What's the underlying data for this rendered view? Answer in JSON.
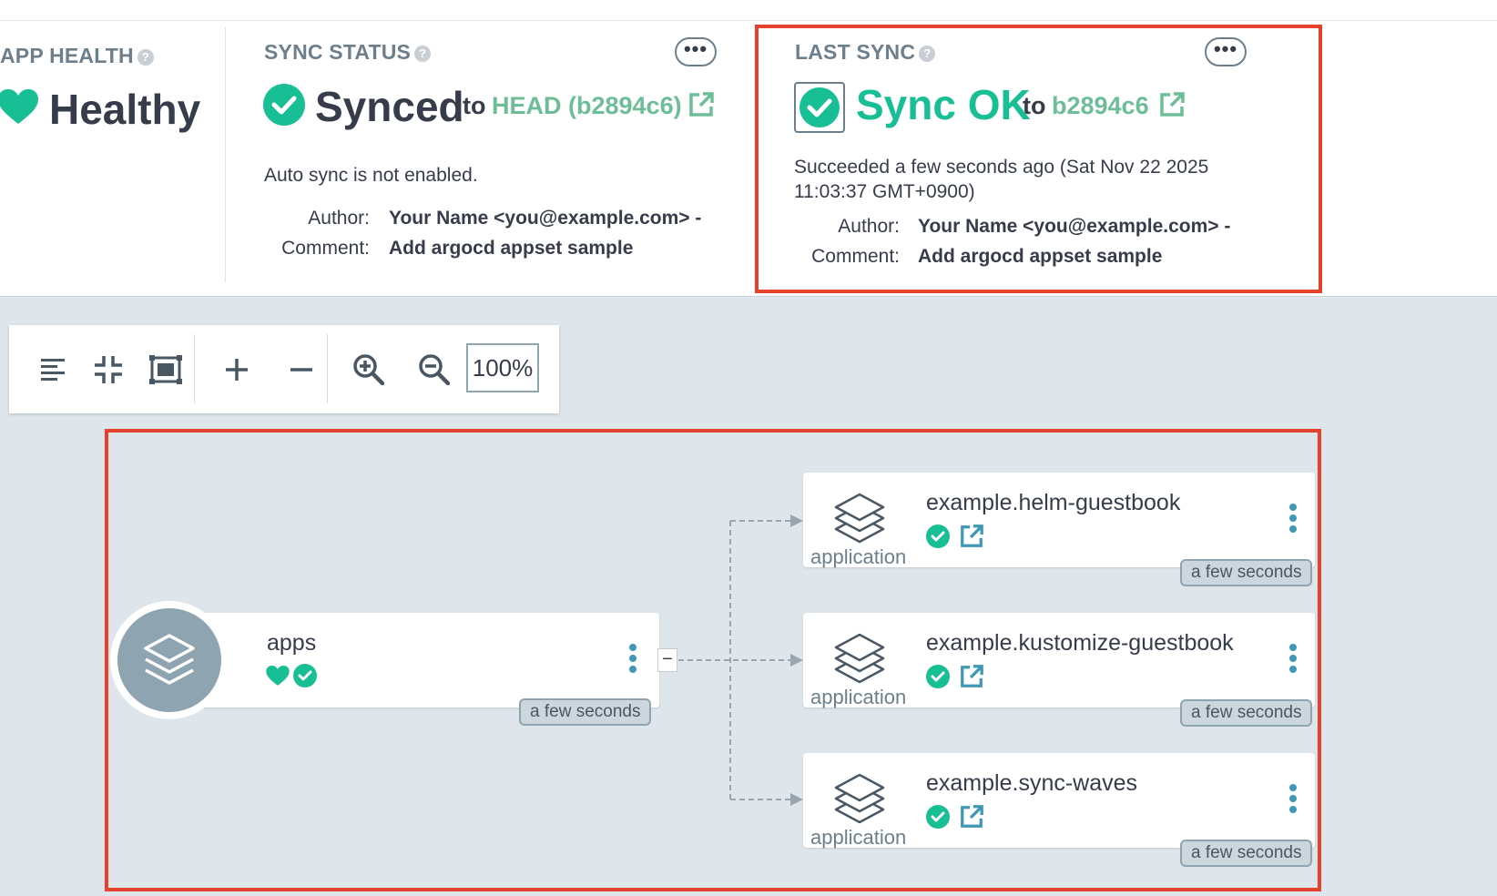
{
  "app_health": {
    "title": "APP HEALTH",
    "status": "Healthy",
    "color": "#18be94"
  },
  "sync_status": {
    "title": "SYNC STATUS",
    "status": "Synced",
    "to": "to",
    "revision": "HEAD (b2894c6)",
    "auto_sync": "Auto sync is not enabled.",
    "author_label": "Author:",
    "author": "Your Name <you@example.com> -",
    "comment_label": "Comment:",
    "comment": "Add argocd appset sample"
  },
  "last_sync": {
    "title": "LAST SYNC",
    "status": "Sync OK",
    "to": "to",
    "revision": "b2894c6",
    "succeeded_line1": "Succeeded a few seconds ago (Sat Nov 22 2025",
    "succeeded_line2": "11:03:37 GMT+0900)",
    "author_label": "Author:",
    "author": "Your Name <you@example.com> -",
    "comment_label": "Comment:",
    "comment": "Add argocd appset sample"
  },
  "toolbar": {
    "zoom": "100%",
    "buttons": [
      "align-left-icon",
      "compress-icon",
      "fit-screen-icon",
      "plus-icon",
      "minus-icon",
      "zoom-in-icon",
      "zoom-out-icon"
    ]
  },
  "graph": {
    "root": {
      "name": "apps",
      "age": "a few seconds"
    },
    "children": [
      {
        "name": "example.helm-guestbook",
        "kind": "application",
        "age": "a few seconds"
      },
      {
        "name": "example.kustomize-guestbook",
        "kind": "application",
        "age": "a few seconds"
      },
      {
        "name": "example.sync-waves",
        "kind": "application",
        "age": "a few seconds"
      }
    ],
    "collapse_symbol": "−"
  },
  "colors": {
    "accent_green": "#18be94",
    "link_green": "#6dbe96",
    "highlight_red": "#e5422d",
    "kebab_blue": "#3f99b6"
  }
}
